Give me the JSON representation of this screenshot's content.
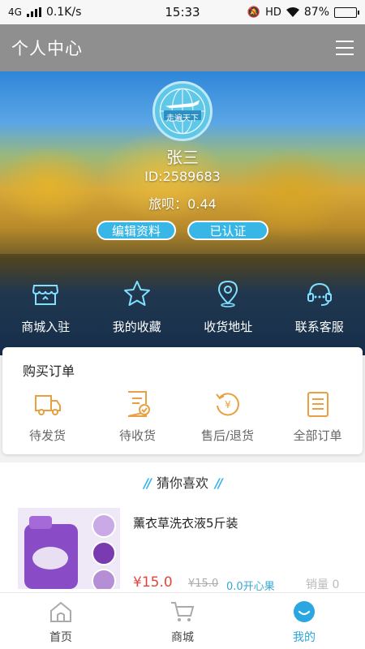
{
  "status_bar": {
    "network": "4G",
    "speed": "0.1K/s",
    "time": "15:33",
    "hd": "HD",
    "battery": "87%",
    "battery_level": 0.87
  },
  "header": {
    "title": "个人中心",
    "menu_icon": "hamburger-menu-icon"
  },
  "profile": {
    "avatar_text": "走遍天下",
    "name": "张三",
    "id": "ID:2589683",
    "points": "旅呗：0.44",
    "edit_label": "编辑资料",
    "verified_label": "已认证"
  },
  "quick_links": [
    {
      "label": "商城入驻",
      "icon": "store-icon"
    },
    {
      "label": "我的收藏",
      "icon": "star-icon"
    },
    {
      "label": "收货地址",
      "icon": "location-pin-icon"
    },
    {
      "label": "联系客服",
      "icon": "headset-icon"
    }
  ],
  "orders": {
    "title": "购买订单",
    "items": [
      {
        "label": "待发货",
        "icon": "truck-icon"
      },
      {
        "label": "待收货",
        "icon": "receive-doc-icon"
      },
      {
        "label": "售后/退货",
        "icon": "refund-icon"
      },
      {
        "label": "全部订单",
        "icon": "order-list-icon"
      }
    ]
  },
  "recommend": {
    "title": "猜你喜欢",
    "products": [
      {
        "name": "薰衣草洗衣液5斤装",
        "price": "¥15.0",
        "original_price": "¥15.0",
        "bonus": "0.0开心果",
        "sales": "销量 0"
      }
    ]
  },
  "bottom_nav": [
    {
      "label": "首页",
      "icon": "home-icon",
      "active": false
    },
    {
      "label": "商城",
      "icon": "cart-icon",
      "active": false
    },
    {
      "label": "我的",
      "icon": "profile-smile-icon",
      "active": true
    }
  ],
  "colors": {
    "accent": "#2aa6e0",
    "order_icon": "#e8a040",
    "price": "#e5443a"
  }
}
